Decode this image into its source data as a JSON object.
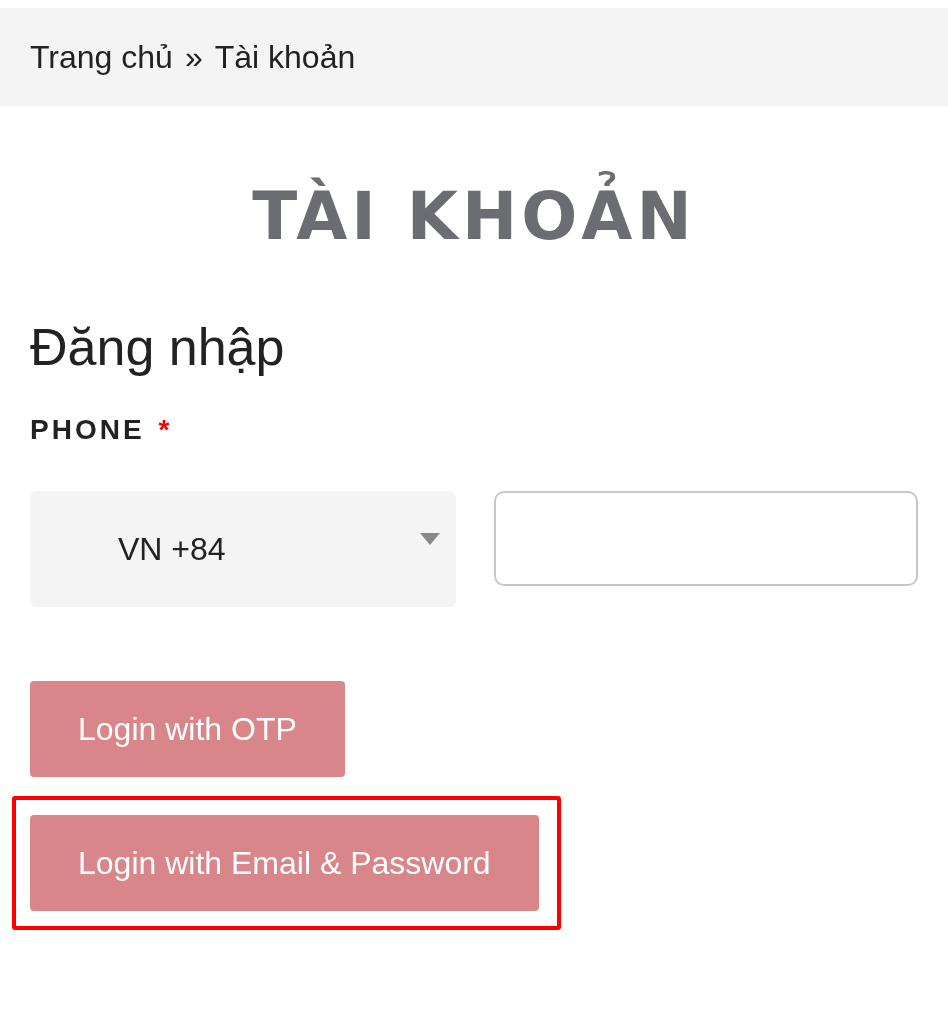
{
  "breadcrumb": {
    "items": [
      "Trang chủ",
      "Tài khoản"
    ],
    "separator": "»"
  },
  "page_title": "TÀI KHOẢN",
  "heading": "Đăng nhập",
  "phone": {
    "label": "PHONE",
    "required_mark": "*",
    "country_code": "VN +84"
  },
  "buttons": [
    {
      "label": "Login with OTP",
      "highlighted": false
    },
    {
      "label": "Login with Email & Password",
      "highlighted": true
    }
  ]
}
